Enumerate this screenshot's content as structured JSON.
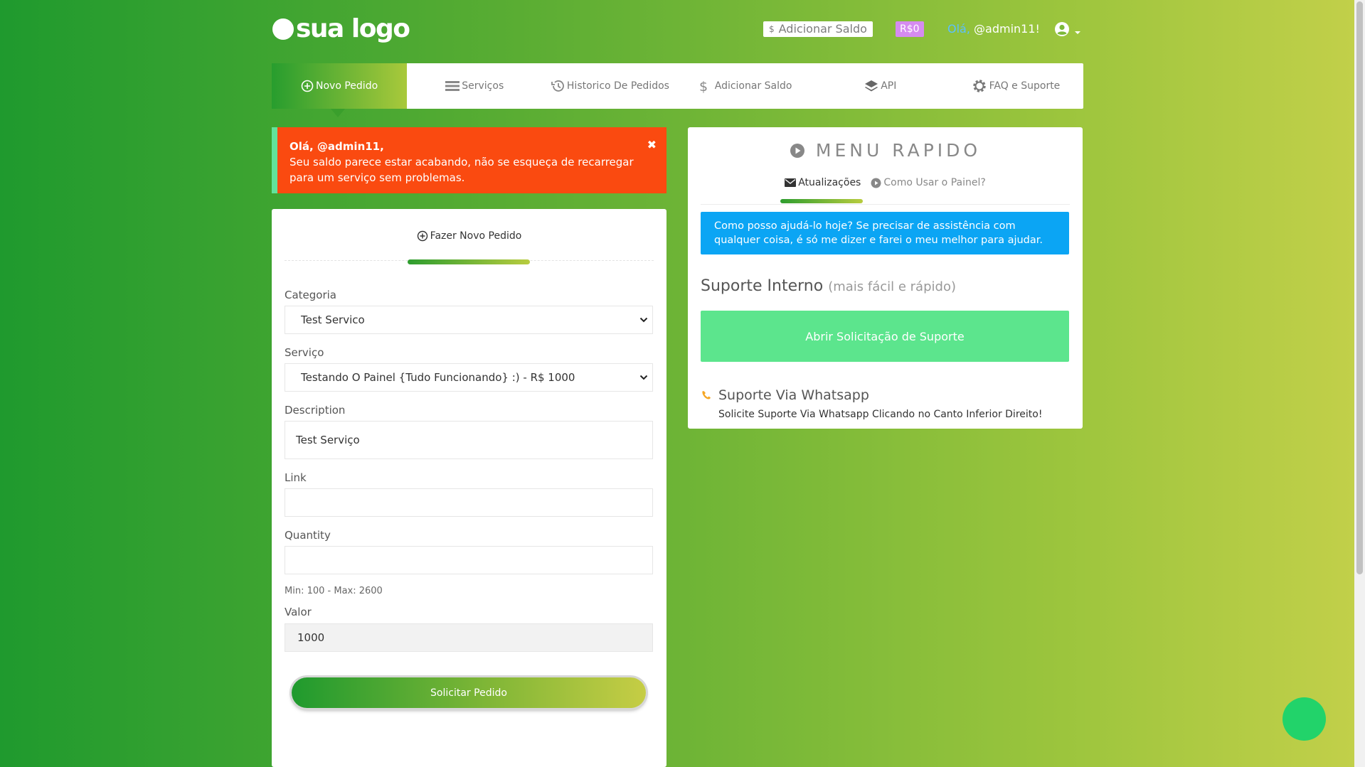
{
  "header": {
    "logo_text": "sua logo",
    "add_balance_label": "Adicionar Saldo",
    "add_balance_icon": "$",
    "balance": "R$0",
    "greeting_hi": "Olá,",
    "greeting_user": "@admin11!"
  },
  "nav": {
    "items": [
      {
        "label": "Novo Pedido",
        "icon": "plus-circle-icon"
      },
      {
        "label": "Serviços",
        "icon": "list-icon"
      },
      {
        "label": "Historico De Pedidos",
        "icon": "history-icon"
      },
      {
        "label": "Adicionar Saldo",
        "icon": "dollar-icon"
      },
      {
        "label": "API",
        "icon": "layers-icon"
      },
      {
        "label": "FAQ e Suporte",
        "icon": "gear-icon"
      }
    ]
  },
  "alert": {
    "hello": "Olá, @admin11,",
    "message": "Seu saldo parece estar acabando, não se esqueça de recarregar para um serviço sem problemas.",
    "close": "✖"
  },
  "order": {
    "tab_label": "Fazer Novo Pedido",
    "categoria_label": "Categoria",
    "categoria_value": "Test Servico",
    "servico_label": "Serviço",
    "servico_value": "Testando O Painel {Tudo Funcionando} :) - R$ 1000",
    "description_label": "Description",
    "description_value": "Test Serviço",
    "link_label": "Link",
    "link_value": "",
    "quantity_label": "Quantity",
    "quantity_value": "",
    "quantity_hint": "Min: 100 - Max: 2600",
    "valor_label": "Valor",
    "valor_value": "1000",
    "submit_label": "Solicitar Pedido"
  },
  "quick_menu": {
    "title": "MENU RAPIDO",
    "tabs": [
      {
        "label": "Atualizações",
        "icon": "envelope-icon",
        "active": true
      },
      {
        "label": "Como Usar o Painel?",
        "icon": "play-circle-icon",
        "active": false
      }
    ],
    "info_text": "Como posso ajudá-lo hoje? Se precisar de assistência com qualquer coisa, é só me dizer e farei o meu melhor para ajudar.",
    "support_title": "Suporte Interno",
    "support_subtitle": "(mais fácil e rápido)",
    "support_button": "Abrir Solicitação de Suporte",
    "whatsapp_title": "Suporte Via Whatsapp",
    "whatsapp_desc": "Solicite Suporte Via Whatsapp Clicando no Canto Inferior Direito!"
  },
  "colors": {
    "alert_bg": "#fa4a10",
    "alert_border": "#62e39b",
    "info_bg": "#0ba5f4",
    "support_btn": "#5ce58d",
    "balance_badge": "#d58bf0",
    "float_btn": "#22d36a"
  }
}
